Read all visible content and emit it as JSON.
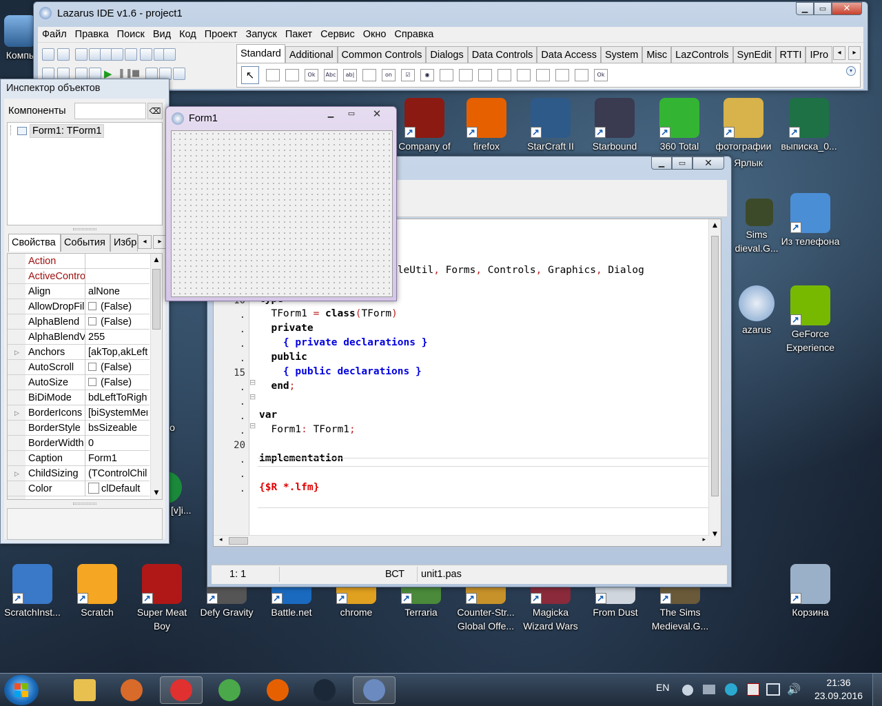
{
  "main_window": {
    "title": "Lazarus IDE v1.6 - project1",
    "menu": [
      "Файл",
      "Правка",
      "Поиск",
      "Вид",
      "Код",
      "Проект",
      "Запуск",
      "Пакет",
      "Сервис",
      "Окно",
      "Справка"
    ],
    "palette_tabs": [
      "Standard",
      "Additional",
      "Common Controls",
      "Dialogs",
      "Data Controls",
      "Data Access",
      "System",
      "Misc",
      "LazControls",
      "SynEdit",
      "RTTI",
      "IPro"
    ],
    "active_tab": "Standard",
    "palette_components": [
      "TMainMenu",
      "TPopupMenu",
      "TButton",
      "TLabel",
      "TEdit",
      "TMemo",
      "TToggleBox",
      "TCheckBox",
      "TRadioButton",
      "TListBox",
      "TComboBox",
      "TScrollBar",
      "TGroupBox",
      "TRadioGroup",
      "TCheckGroup",
      "TPanel",
      "TFrame",
      "TActionList"
    ],
    "palette_glyphs": [
      "",
      "",
      "Ok",
      "Abc",
      "ab|",
      "",
      "on",
      "☑",
      "◉",
      "",
      "",
      "",
      "",
      "",
      "",
      "",
      "",
      "Ok"
    ]
  },
  "inspector": {
    "title": "Инспектор объектов",
    "components_label": "Компоненты",
    "tree_item": "Form1: TForm1",
    "tabs": [
      "Свойства",
      "События",
      "Избранное"
    ],
    "properties": [
      {
        "name": "Action",
        "value": "",
        "red": true
      },
      {
        "name": "ActiveControl",
        "value": "",
        "red": true
      },
      {
        "name": "Align",
        "value": "alNone"
      },
      {
        "name": "AllowDropFiles",
        "value": "(False)",
        "check": true
      },
      {
        "name": "AlphaBlend",
        "value": "(False)",
        "check": true
      },
      {
        "name": "AlphaBlendValue",
        "value": "255"
      },
      {
        "name": "Anchors",
        "value": "[akTop,akLeft]",
        "expand": true
      },
      {
        "name": "AutoScroll",
        "value": "(False)",
        "check": true
      },
      {
        "name": "AutoSize",
        "value": "(False)",
        "check": true
      },
      {
        "name": "BiDiMode",
        "value": "bdLeftToRight"
      },
      {
        "name": "BorderIcons",
        "value": "[biSystemMenu]",
        "expand": true
      },
      {
        "name": "BorderStyle",
        "value": "bsSizeable"
      },
      {
        "name": "BorderWidth",
        "value": "0"
      },
      {
        "name": "Caption",
        "value": "Form1"
      },
      {
        "name": "ChildSizing",
        "value": "(TControlChildSizing)",
        "expand": true
      },
      {
        "name": "Color",
        "value": "clDefault",
        "swatch": true
      }
    ]
  },
  "form1": {
    "title": "Form1"
  },
  "editor": {
    "code_lines": [
      {
        "n": "",
        "html": ""
      },
      {
        "n": ".",
        "html": "<span class='kw'>uses</span>"
      },
      {
        "n": ".",
        "html": "  Classes<span class='sym'>,</span> SysUtils<span class='sym'>,</span> FileUtil<span class='sym'>,</span> Forms<span class='sym'>,</span> Controls<span class='sym'>,</span> Graphics<span class='sym'>,</span> Dialog"
      },
      {
        "n": ".",
        "html": ""
      },
      {
        "n": "10",
        "html": "<span class='kw'>type</span>"
      },
      {
        "n": ".",
        "html": "  TForm1 <span class='sym'>=</span> <span class='kw'>class</span><span class='sym'>(</span>TForm<span class='sym'>)</span>"
      },
      {
        "n": ".",
        "html": "  <span class='kw'>private</span>"
      },
      {
        "n": ".",
        "html": "    <span class='cm'>{ private declarations }</span>"
      },
      {
        "n": ".",
        "html": "  <span class='kw'>public</span>"
      },
      {
        "n": "15",
        "html": "    <span class='cm'>{ public declarations }</span>"
      },
      {
        "n": ".",
        "html": "  <span class='kw'>end</span><span class='sym'>;</span>"
      },
      {
        "n": ".",
        "html": ""
      },
      {
        "n": ".",
        "html": "<span class='kw'>var</span>"
      },
      {
        "n": ".",
        "html": "  Form1<span class='sym'>:</span> TForm1<span class='sym'>;</span>"
      },
      {
        "n": "20",
        "html": ""
      },
      {
        "n": ".",
        "html": "<span class='kw'>implementation</span>"
      },
      {
        "n": ".",
        "html": ""
      },
      {
        "n": ".",
        "html": "<span class='dir'>{$R *.lfm}</span>"
      }
    ],
    "status_pos": "1:  1",
    "status_mode": "ВСТ",
    "status_file": "unit1.pas"
  },
  "desktop": {
    "icons_top": [
      {
        "label": "Company of",
        "color": "#8b1a12"
      },
      {
        "label": "firefox",
        "color": "#e66000"
      },
      {
        "label": "StarCraft II",
        "color": "#2e5a8a"
      },
      {
        "label": "Starbound",
        "color": "#3a3a50"
      },
      {
        "label": "360 Total",
        "color": "#33b533"
      },
      {
        "label": "фотографии",
        "color": "#d8b24a"
      },
      {
        "label": "выписка_0...",
        "color": "#1e7145"
      }
    ],
    "label_yarlyk": "Ярлык",
    "icons_right": [
      {
        "label": "Из телефона",
        "color": "#4a8ed6"
      },
      {
        "label": "GeForce Experience",
        "color": "#76b900"
      },
      {
        "label": "Корзина",
        "color": "#9ab0c8"
      }
    ],
    "partial_left": [
      {
        "label": "Компь"
      },
      {
        "label": "Sims"
      },
      {
        "label": "dieval.G..."
      },
      {
        "label": "azarus"
      },
      {
        "label": "[v]i..."
      },
      {
        "label": "o"
      }
    ],
    "icons_bottom": [
      {
        "label": "ScratchInst...",
        "color": "#3a78c8"
      },
      {
        "label": "Scratch",
        "color": "#f5a623"
      },
      {
        "label": "Super Meat Boy",
        "color": "#b01818"
      },
      {
        "label": "Defy Gravity",
        "color": "#555"
      },
      {
        "label": "Battle.net",
        "color": "#1a6ac0"
      },
      {
        "label": "chrome",
        "color": "#e0a020"
      },
      {
        "label": "Terraria",
        "color": "#4a8a3a"
      },
      {
        "label": "Counter-Str... Global Offe...",
        "color": "#c8922a"
      },
      {
        "label": "Magicka Wizard Wars",
        "color": "#8a2a3a"
      },
      {
        "label": "From Dust",
        "color": "#cfd6de"
      },
      {
        "label": "The Sims Medieval.G...",
        "color": "#6a5a3a"
      }
    ]
  },
  "taskbar": {
    "start_label": "Start",
    "pinned": [
      "explorer-icon",
      "media-player-icon",
      "yandex-icon",
      "chrome-icon",
      "firefox-icon",
      "steam-icon",
      "lazarus-icon"
    ],
    "lang": "EN",
    "time": "21:36",
    "date": "23.09.2016"
  }
}
